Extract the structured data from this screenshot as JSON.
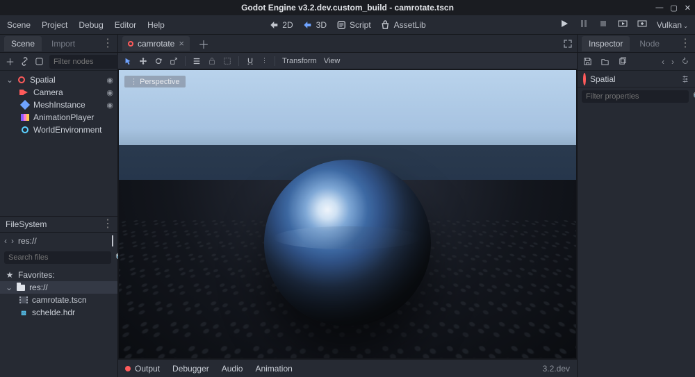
{
  "window": {
    "title": "Godot Engine v3.2.dev.custom_build - camrotate.tscn"
  },
  "menubar": {
    "items": [
      "Scene",
      "Project",
      "Debug",
      "Editor",
      "Help"
    ],
    "workspaces": {
      "2d": "2D",
      "3d": "3D",
      "script": "Script",
      "assetlib": "AssetLib"
    },
    "renderer": "Vulkan"
  },
  "scene_dock": {
    "tabs": {
      "scene": "Scene",
      "import": "Import"
    },
    "filter_placeholder": "Filter nodes",
    "tree": [
      {
        "name": "Spatial",
        "icon": "spatial",
        "depth": 0,
        "expandable": true,
        "expanded": true,
        "visible_toggle": true
      },
      {
        "name": "Camera",
        "icon": "camera",
        "depth": 1,
        "expandable": false,
        "expanded": false,
        "visible_toggle": true
      },
      {
        "name": "MeshInstance",
        "icon": "mesh",
        "depth": 1,
        "expandable": false,
        "expanded": false,
        "visible_toggle": true
      },
      {
        "name": "AnimationPlayer",
        "icon": "anim",
        "depth": 1,
        "expandable": false,
        "expanded": false,
        "visible_toggle": false
      },
      {
        "name": "WorldEnvironment",
        "icon": "env",
        "depth": 1,
        "expandable": false,
        "expanded": false,
        "visible_toggle": false
      }
    ]
  },
  "filesystem": {
    "title": "FileSystem",
    "path": "res://",
    "search_placeholder": "Search files",
    "favorites_label": "Favorites:",
    "items": [
      {
        "name": "res://",
        "icon": "folder",
        "depth": 0,
        "selected": true
      },
      {
        "name": "camrotate.tscn",
        "icon": "scene",
        "depth": 1,
        "selected": false
      },
      {
        "name": "schelde.hdr",
        "icon": "hdr",
        "depth": 1,
        "selected": false
      }
    ]
  },
  "viewport": {
    "scene_tab": "camrotate",
    "perspective_label": "Perspective",
    "toolbar": {
      "transform": "Transform",
      "view": "View"
    },
    "bottom": {
      "output": "Output",
      "debugger": "Debugger",
      "audio": "Audio",
      "animation": "Animation",
      "version": "3.2.dev"
    }
  },
  "inspector": {
    "tabs": {
      "inspector": "Inspector",
      "node": "Node"
    },
    "object": "Spatial",
    "filter_placeholder": "Filter properties"
  }
}
